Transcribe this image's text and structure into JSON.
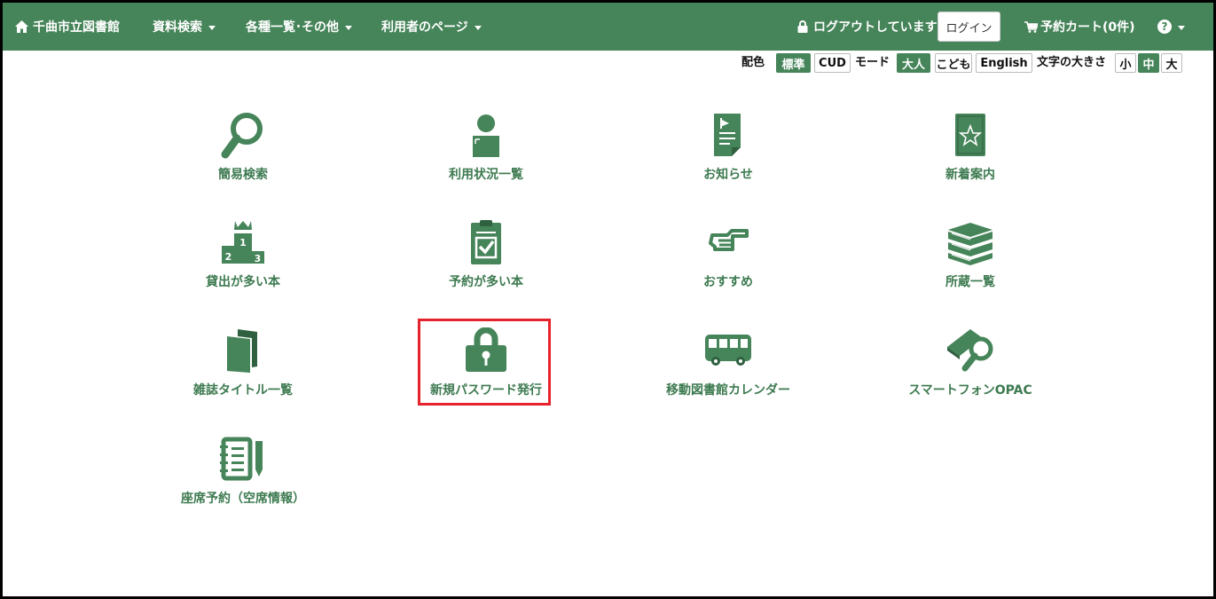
{
  "navbar": {
    "brand": "千曲市立図書館",
    "menus": [
      "資料検索",
      "各種一覧･その他",
      "利用者のページ"
    ],
    "logout_status": "ログアウトしています",
    "login_button": "ログイン",
    "cart": "予約カート(0件)",
    "help_icon": "?"
  },
  "settings": {
    "color_label": "配色",
    "color_options": [
      "標準",
      "CUD"
    ],
    "color_selected": "標準",
    "mode_label": "モード",
    "mode_options": [
      "大人",
      "こども",
      "English"
    ],
    "mode_selected": "大人",
    "size_label": "文字の大きさ",
    "size_options": [
      "小",
      "中",
      "大"
    ],
    "size_selected": "中"
  },
  "tiles": [
    {
      "label": "簡易検索",
      "icon": "magnifier-icon"
    },
    {
      "label": "利用状況一覧",
      "icon": "user-icon"
    },
    {
      "label": "お知らせ",
      "icon": "notice-document-icon"
    },
    {
      "label": "新着案内",
      "icon": "star-book-icon"
    },
    {
      "label": "貸出が多い本",
      "icon": "ranking-podium-icon"
    },
    {
      "label": "予約が多い本",
      "icon": "clipboard-check-icon"
    },
    {
      "label": "おすすめ",
      "icon": "pointing-hand-icon"
    },
    {
      "label": "所蔵一覧",
      "icon": "book-stack-icon"
    },
    {
      "label": "雑誌タイトル一覧",
      "icon": "magazine-icon"
    },
    {
      "label": "新規パスワード発行",
      "icon": "padlock-icon"
    },
    {
      "label": "移動図書館カレンダー",
      "icon": "bus-icon"
    },
    {
      "label": "スマートフォンOPAC",
      "icon": "book-search-icon"
    },
    {
      "label": "座席予約（空席情報）",
      "icon": "notebook-pen-icon"
    }
  ],
  "colors": {
    "primary": "#468459",
    "tile_text": "#3d7a50",
    "highlight": "#e6232c"
  }
}
